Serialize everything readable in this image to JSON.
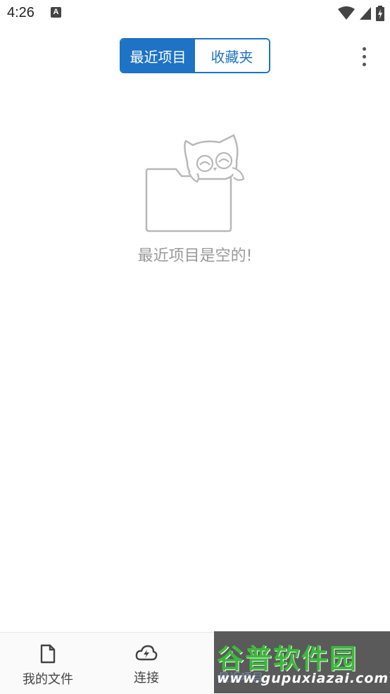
{
  "status_bar": {
    "time": "4:26",
    "notification_icon": "A",
    "icons": [
      "wifi-icon",
      "signal-icon",
      "battery-charging-icon"
    ]
  },
  "header": {
    "tabs": [
      {
        "label": "最近项目",
        "active": true
      },
      {
        "label": "收藏夹",
        "active": false
      }
    ],
    "more_icon": "more-vertical-icon"
  },
  "empty_state": {
    "illustration": "owl-folder-illustration",
    "message": "最近项目是空的!"
  },
  "bottom_nav": {
    "items": [
      {
        "label": "我的文件",
        "icon": "file-icon"
      },
      {
        "label": "连接",
        "icon": "cloud-lightning-icon"
      },
      {
        "label": "最近项目",
        "icon": "clock-icon"
      }
    ]
  },
  "watermark": {
    "brand": "谷普软件园",
    "url": "www.gupuxiazai.com"
  },
  "colors": {
    "accent": "#1e73c4",
    "muted_text": "#9a9a9a",
    "watermark_green": "#3ab93a"
  }
}
